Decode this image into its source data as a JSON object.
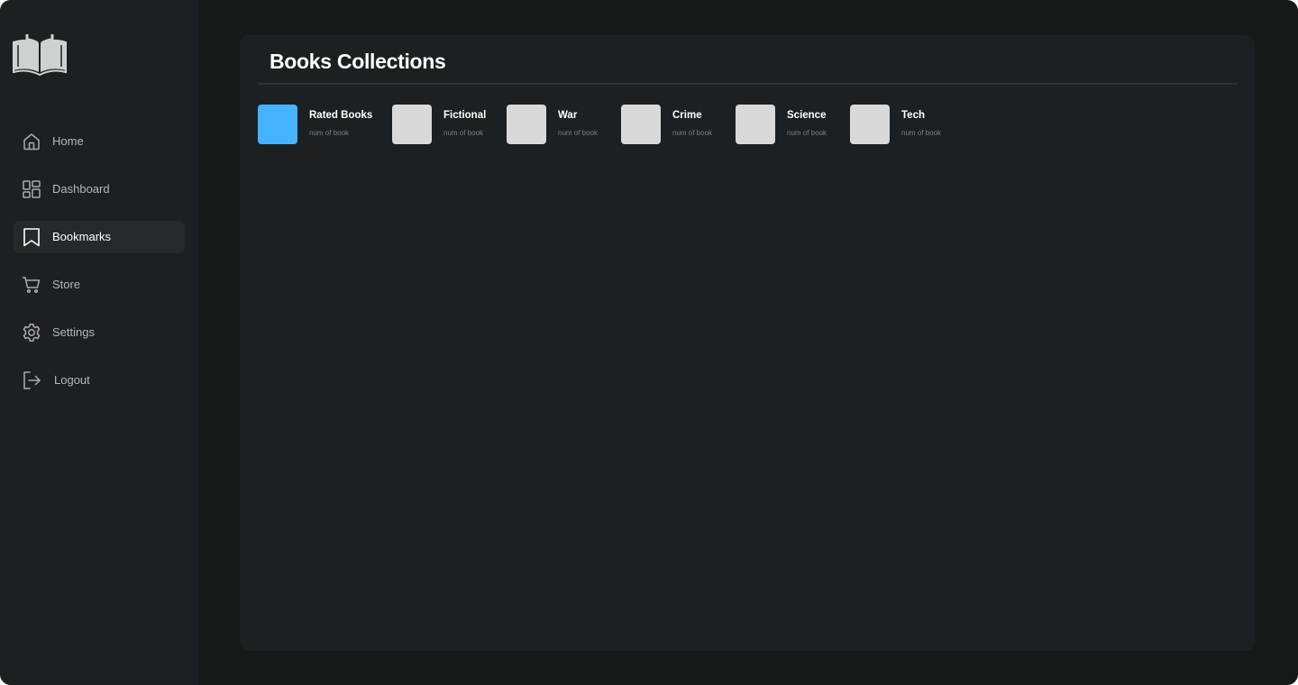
{
  "sidebar": {
    "logo_icon": "open-book-icon",
    "items": [
      {
        "label": "Home",
        "icon": "home-icon",
        "active": false
      },
      {
        "label": "Dashboard",
        "icon": "dashboard-icon",
        "active": false
      },
      {
        "label": "Bookmarks",
        "icon": "bookmark-icon",
        "active": true
      },
      {
        "label": "Store",
        "icon": "cart-icon",
        "active": false
      },
      {
        "label": "Settings",
        "icon": "gear-icon",
        "active": false
      },
      {
        "label": "Logout",
        "icon": "logout-icon",
        "active": false
      }
    ]
  },
  "main": {
    "title": "Books Collections",
    "collections": [
      {
        "name": "Rated Books",
        "subtitle": "num of book",
        "color": "#45b3ff"
      },
      {
        "name": "Fictional",
        "subtitle": "num of book",
        "color": "#d9d9d9"
      },
      {
        "name": "War",
        "subtitle": "num of book",
        "color": "#d9d9d9"
      },
      {
        "name": "Crime",
        "subtitle": "num of book",
        "color": "#d9d9d9"
      },
      {
        "name": "Science",
        "subtitle": "num of book",
        "color": "#d9d9d9"
      },
      {
        "name": "Tech",
        "subtitle": "num of book",
        "color": "#d9d9d9"
      }
    ]
  },
  "colors": {
    "background": "#171818",
    "panel": "#1d2022",
    "active_nav": "#25292b",
    "accent": "#45b3ff",
    "placeholder": "#d9d9d9"
  }
}
